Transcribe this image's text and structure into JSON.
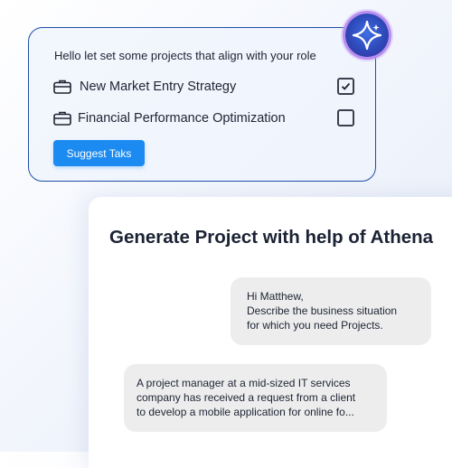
{
  "suggest_card": {
    "greeting": "Hello let set some projects that align with your role",
    "projects": [
      {
        "label": "New Market Entry Strategy",
        "checked": true,
        "icon": "briefcase-icon"
      },
      {
        "label": "Financial Performance Optimization",
        "checked": false,
        "icon": "briefcase-icon"
      }
    ],
    "button_label": "Suggest Taks"
  },
  "assistant_badge": {
    "icon": "sparkle-icon"
  },
  "chat": {
    "title": "Generate Project with help of Athena",
    "messages": [
      {
        "role": "assistant",
        "lines": [
          "Hi Matthew,",
          "Describe the business situation",
          "for which you need Projects."
        ]
      },
      {
        "role": "user",
        "lines": [
          "A project manager at a mid-sized IT services",
          "company has received a request from a client",
          "to develop a mobile application for online fo..."
        ]
      }
    ]
  },
  "colors": {
    "accent": "#1b8af1",
    "card_border": "#1f4fa8",
    "bubble_bg": "#ededed",
    "badge_ring": "#b98ef0"
  }
}
